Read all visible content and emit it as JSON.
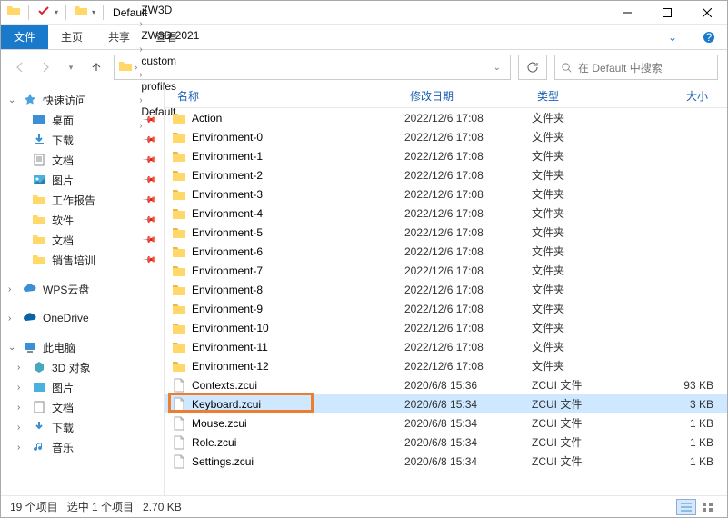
{
  "title": "Default",
  "ribbon": {
    "file": "文件",
    "home": "主页",
    "share": "共享",
    "view": "查看"
  },
  "breadcrumbs": [
    "ZW3D",
    "ZW3D 2021",
    "custom",
    "profiles",
    "Default"
  ],
  "search_placeholder": "在 Default 中搜索",
  "columns": {
    "name": "名称",
    "date": "修改日期",
    "type": "类型",
    "size": "大小"
  },
  "sidebar": {
    "quick_access": "快速访问",
    "desktop": "桌面",
    "downloads": "下载",
    "documents": "文档",
    "pictures": "图片",
    "work_report": "工作报告",
    "software": "软件",
    "docs2": "文档",
    "sales_training": "销售培训",
    "wps_cloud": "WPS云盘",
    "onedrive": "OneDrive",
    "this_pc": "此电脑",
    "objects_3d": "3D 对象",
    "pictures2": "图片",
    "documents2": "文档",
    "downloads2": "下载",
    "music": "音乐"
  },
  "files": [
    {
      "name": "Action",
      "date": "2022/12/6 17:08",
      "type": "文件夹",
      "size": "",
      "kind": "folder"
    },
    {
      "name": "Environment-0",
      "date": "2022/12/6 17:08",
      "type": "文件夹",
      "size": "",
      "kind": "folder"
    },
    {
      "name": "Environment-1",
      "date": "2022/12/6 17:08",
      "type": "文件夹",
      "size": "",
      "kind": "folder"
    },
    {
      "name": "Environment-2",
      "date": "2022/12/6 17:08",
      "type": "文件夹",
      "size": "",
      "kind": "folder"
    },
    {
      "name": "Environment-3",
      "date": "2022/12/6 17:08",
      "type": "文件夹",
      "size": "",
      "kind": "folder"
    },
    {
      "name": "Environment-4",
      "date": "2022/12/6 17:08",
      "type": "文件夹",
      "size": "",
      "kind": "folder"
    },
    {
      "name": "Environment-5",
      "date": "2022/12/6 17:08",
      "type": "文件夹",
      "size": "",
      "kind": "folder"
    },
    {
      "name": "Environment-6",
      "date": "2022/12/6 17:08",
      "type": "文件夹",
      "size": "",
      "kind": "folder"
    },
    {
      "name": "Environment-7",
      "date": "2022/12/6 17:08",
      "type": "文件夹",
      "size": "",
      "kind": "folder"
    },
    {
      "name": "Environment-8",
      "date": "2022/12/6 17:08",
      "type": "文件夹",
      "size": "",
      "kind": "folder"
    },
    {
      "name": "Environment-9",
      "date": "2022/12/6 17:08",
      "type": "文件夹",
      "size": "",
      "kind": "folder"
    },
    {
      "name": "Environment-10",
      "date": "2022/12/6 17:08",
      "type": "文件夹",
      "size": "",
      "kind": "folder"
    },
    {
      "name": "Environment-11",
      "date": "2022/12/6 17:08",
      "type": "文件夹",
      "size": "",
      "kind": "folder"
    },
    {
      "name": "Environment-12",
      "date": "2022/12/6 17:08",
      "type": "文件夹",
      "size": "",
      "kind": "folder"
    },
    {
      "name": "Contexts.zcui",
      "date": "2020/6/8 15:36",
      "type": "ZCUI 文件",
      "size": "93 KB",
      "kind": "file"
    },
    {
      "name": "Keyboard.zcui",
      "date": "2020/6/8 15:34",
      "type": "ZCUI 文件",
      "size": "3 KB",
      "kind": "file",
      "selected": true,
      "highlight": true
    },
    {
      "name": "Mouse.zcui",
      "date": "2020/6/8 15:34",
      "type": "ZCUI 文件",
      "size": "1 KB",
      "kind": "file"
    },
    {
      "name": "Role.zcui",
      "date": "2020/6/8 15:34",
      "type": "ZCUI 文件",
      "size": "1 KB",
      "kind": "file"
    },
    {
      "name": "Settings.zcui",
      "date": "2020/6/8 15:34",
      "type": "ZCUI 文件",
      "size": "1 KB",
      "kind": "file"
    }
  ],
  "status": {
    "count": "19 个项目",
    "selected": "选中 1 个项目",
    "size": "2.70 KB"
  }
}
